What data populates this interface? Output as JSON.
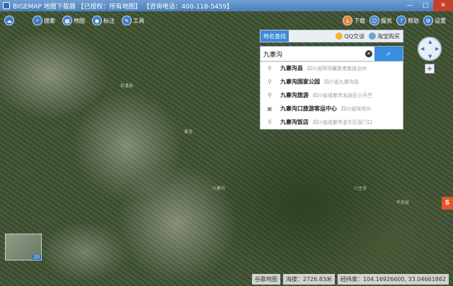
{
  "window": {
    "title": "BIGEMAP 地图下载器 【已授权：所有地图】 【咨询电话：400-118-5459】",
    "minimize": "—",
    "maximize": "□",
    "close": "✕"
  },
  "toolbar": {
    "left_items": [
      {
        "icon": "layer-icon",
        "label": ""
      },
      {
        "icon": "search-icon",
        "label": "搜索"
      },
      {
        "icon": "map-type-icon",
        "label": "地图"
      },
      {
        "icon": "marker-icon",
        "label": "标注"
      },
      {
        "icon": "tools-icon",
        "label": "工具"
      }
    ],
    "right_items": [
      {
        "icon": "download-icon",
        "label": "下载"
      },
      {
        "icon": "service-icon",
        "label": "服务"
      },
      {
        "icon": "help-icon",
        "label": "帮助"
      },
      {
        "icon": "settings-icon",
        "label": "设置"
      }
    ]
  },
  "search_panel": {
    "tab_label": "地名查找",
    "qq_label": "QQ交谈",
    "shop_label": "淘宝购买",
    "query": "九寨沟",
    "go_icon": "search-icon",
    "results": [
      {
        "name": "九寨沟县",
        "address": "四川省阿坝藏族羌族自治州"
      },
      {
        "name": "九寨沟国家公园",
        "address": "四川省九寨沟县"
      },
      {
        "name": "九寨沟旅游",
        "address": "四川省成都市龙泉区小天竺"
      },
      {
        "name": "九寨沟口旅游客运中心",
        "address": "四川省阿坝州"
      },
      {
        "name": "九寨沟饭店",
        "address": "四川省成都市金牛区营门口"
      }
    ]
  },
  "map_labels": [
    "松潘县",
    "黄龙",
    "九寨沟",
    "川主寺",
    "平武县"
  ],
  "minimap": {
    "tag": "2D"
  },
  "status": {
    "source": "谷歌地图",
    "altitude": "海拔：2726.83米",
    "coords": "经纬度：104.16926600, 33.04661862"
  },
  "side_logo": "S"
}
